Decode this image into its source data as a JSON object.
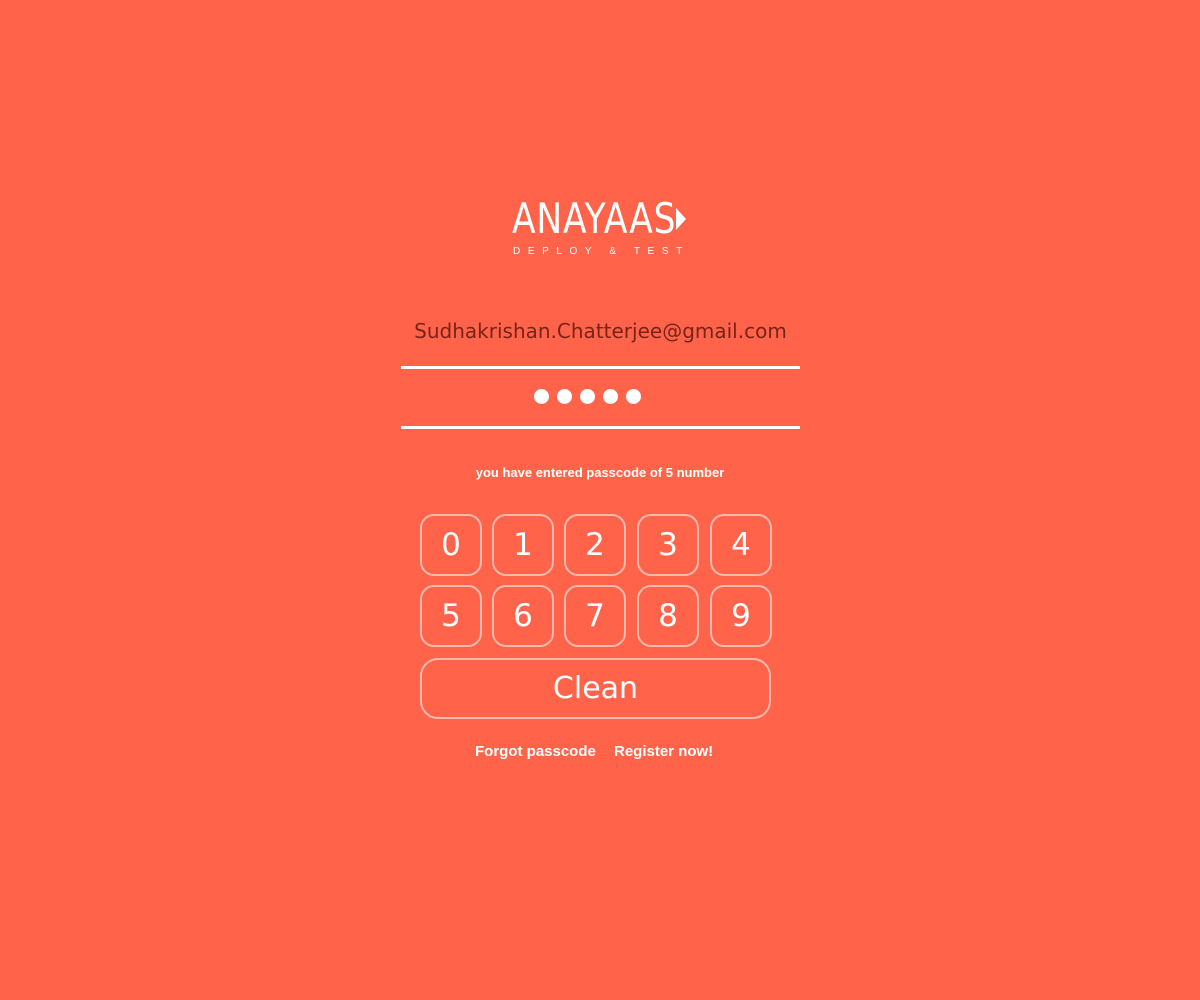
{
  "colors": {
    "background": "#FF644B",
    "foreground": "#FFFFFF",
    "email_text": "#7A2218"
  },
  "logo": {
    "wordmark": "ANAYAAS",
    "tagline": "DEPLOY & TEST",
    "icon": "play-triangle-icon"
  },
  "login": {
    "email": "Sudhakrishan.Chatterjee@gmail.com",
    "passcode_length": 5,
    "hint": "you have entered passcode of 5 number"
  },
  "keypad": {
    "keys": [
      "0",
      "1",
      "2",
      "3",
      "4",
      "5",
      "6",
      "7",
      "8",
      "9"
    ],
    "clean_label": "Clean"
  },
  "links": {
    "forgot": "Forgot passcode",
    "register": "Register now!"
  }
}
